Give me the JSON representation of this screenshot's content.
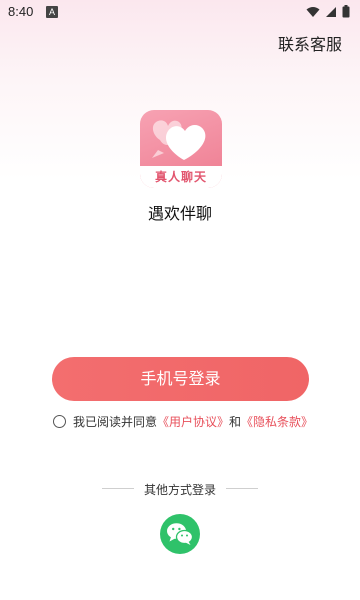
{
  "status_bar": {
    "time": "8:40",
    "notification_glyph": "A",
    "icons": [
      "wifi-icon",
      "signal-icon",
      "battery-icon"
    ]
  },
  "header": {
    "customer_service_label": "联系客服"
  },
  "app": {
    "logo_text": "真人聊天",
    "name": "遇欢伴聊"
  },
  "login": {
    "phone_login_label": "手机号登录"
  },
  "agreement": {
    "prefix": "我已阅读并同意",
    "user_agreement_link": "《用户协议》",
    "and": "和",
    "privacy_policy_link": "《隐私条款》",
    "checked": false
  },
  "other_login": {
    "label": "其他方式登录",
    "methods": [
      "wechat-icon"
    ]
  },
  "colors": {
    "primary_button": "#f06566",
    "link": "#e8505b",
    "wechat": "#2fc26a",
    "logo_pink": "#ee7c90"
  }
}
